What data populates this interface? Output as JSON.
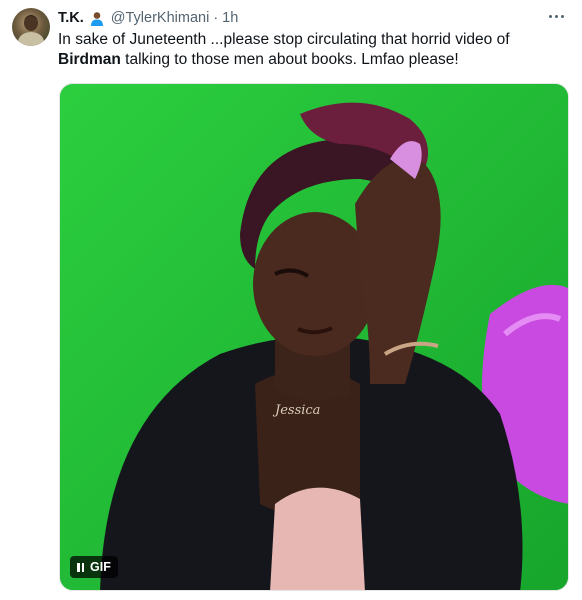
{
  "tweet": {
    "author": {
      "display_name": "T.K.",
      "name_emoji": "person-emoji",
      "handle": "@TylerKhimani",
      "separator": "·",
      "time": "1h",
      "avatar": "user-avatar"
    },
    "text_before_bold": "In sake of Juneteenth ...please stop circulating that horrid video of ",
    "text_bold": "Birdman",
    "text_after_bold": " talking to those men about books. Lmfao please!",
    "media": {
      "kind": "gif",
      "badge_label": "GIF",
      "pause_icon": "pause-icon",
      "background_color": "#22c03a"
    },
    "more_icon": "more-horizontal-icon"
  }
}
